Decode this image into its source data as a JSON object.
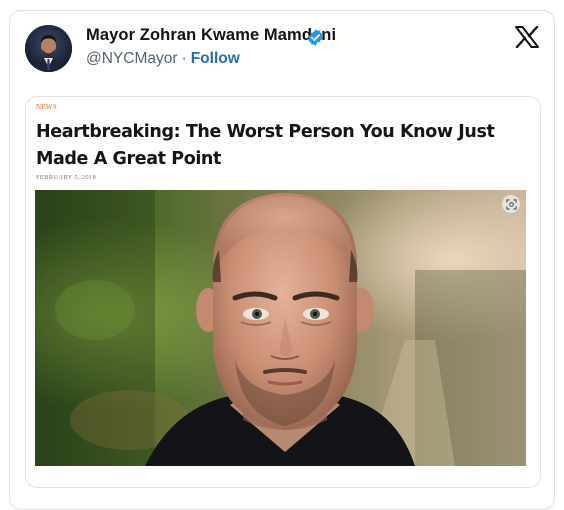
{
  "tweet": {
    "author": {
      "display_name": "Mayor Zohran Kwame Mamdani",
      "handle": "@NYCMayor",
      "separator": "·",
      "follow_label": "Follow",
      "verified_icon": "verified-badge-icon",
      "avatar": "avatar-photo"
    },
    "platform_icon": "x-logo-icon",
    "article": {
      "kicker": "NEWS",
      "headline": "Heartbreaking: The Worst Person You Know Just Made A Great Point",
      "date": "FEBRUARY 5, 2018",
      "image": "portrait-photo-of-bald-man",
      "image_search_icon": "lens-icon"
    }
  },
  "colors": {
    "verified_blue": "#1d9bf0",
    "follow_link": "#1d6fb8",
    "kicker_orange": "#e0653a",
    "handle_gray": "#536471"
  }
}
